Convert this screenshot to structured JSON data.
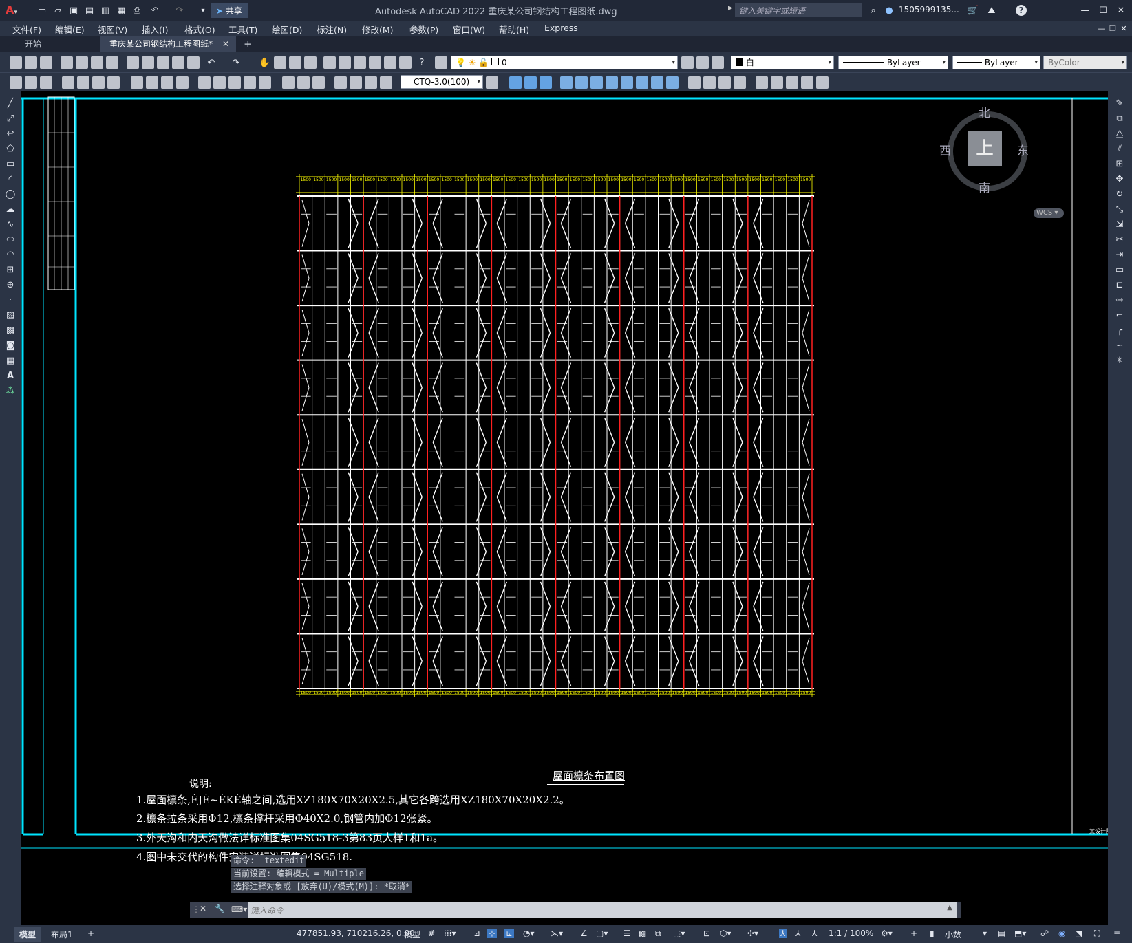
{
  "app": {
    "title": "Autodesk AutoCAD 2022    重庆某公司钢结构工程图纸.dwg",
    "share_label": "共享",
    "search_placeholder": "键入关键字或短语",
    "user": "1505999135...",
    "help": "?"
  },
  "menu": [
    "文件(F)",
    "编辑(E)",
    "视图(V)",
    "插入(I)",
    "格式(O)",
    "工具(T)",
    "绘图(D)",
    "标注(N)",
    "修改(M)",
    "参数(P)",
    "窗口(W)",
    "帮助(H)",
    "Express"
  ],
  "tabs": [
    {
      "label": "开始",
      "active": false
    },
    {
      "label": "重庆某公司钢结构工程图纸*",
      "active": true
    }
  ],
  "toolbar": {
    "layer_value": "0",
    "color_value": "白",
    "linetype_value": "ByLayer",
    "lineweight_value": "ByLayer",
    "plotstyle_value": "ByColor",
    "dimstyle_value": "CTQ-3.0(100)"
  },
  "viewcube": {
    "north": "北",
    "south": "南",
    "east": "东",
    "west": "西",
    "face": "上",
    "wcs": "WCS"
  },
  "drawing": {
    "title": "屋面檩条布置图",
    "notes_heading": "说明:",
    "notes": [
      "1.屋面檩条,ÈJÉ~ÈKÉ轴之间,选用XZ180X70X20X2.5,其它各跨选用XZ180X70X20X2.2。",
      "2.檩条拉条采用Φ12,檩条撑杆采用Φ40X2.0,钢管内加Φ12张紧。",
      "3.外天沟和内天沟做法详标准图集04SG518-3第83页大样1和1a。",
      "4.图中未交代的构件安装详标准图集04SG518."
    ],
    "dim_label": "1500",
    "side_stamp": "某设计院"
  },
  "command": {
    "history": [
      "命令: _textedit",
      "当前设置: 编辑模式 = Multiple",
      "选择注释对象或 [放弃(U)/模式(M)]: *取消*"
    ],
    "placeholder": "键入命令"
  },
  "status": {
    "layout_tabs": [
      "模型",
      "布局1"
    ],
    "add_tab": "+",
    "coords": "477851.93, 710216.26, 0.00",
    "model_label": "模型",
    "scale": "1:1 / 100%",
    "units": "小数"
  },
  "colors": {
    "cyan_frame": "#00e5ff",
    "yellow_dim": "#ffff00",
    "red_axis": "#ff2020",
    "ui_bg": "#2b3445"
  }
}
